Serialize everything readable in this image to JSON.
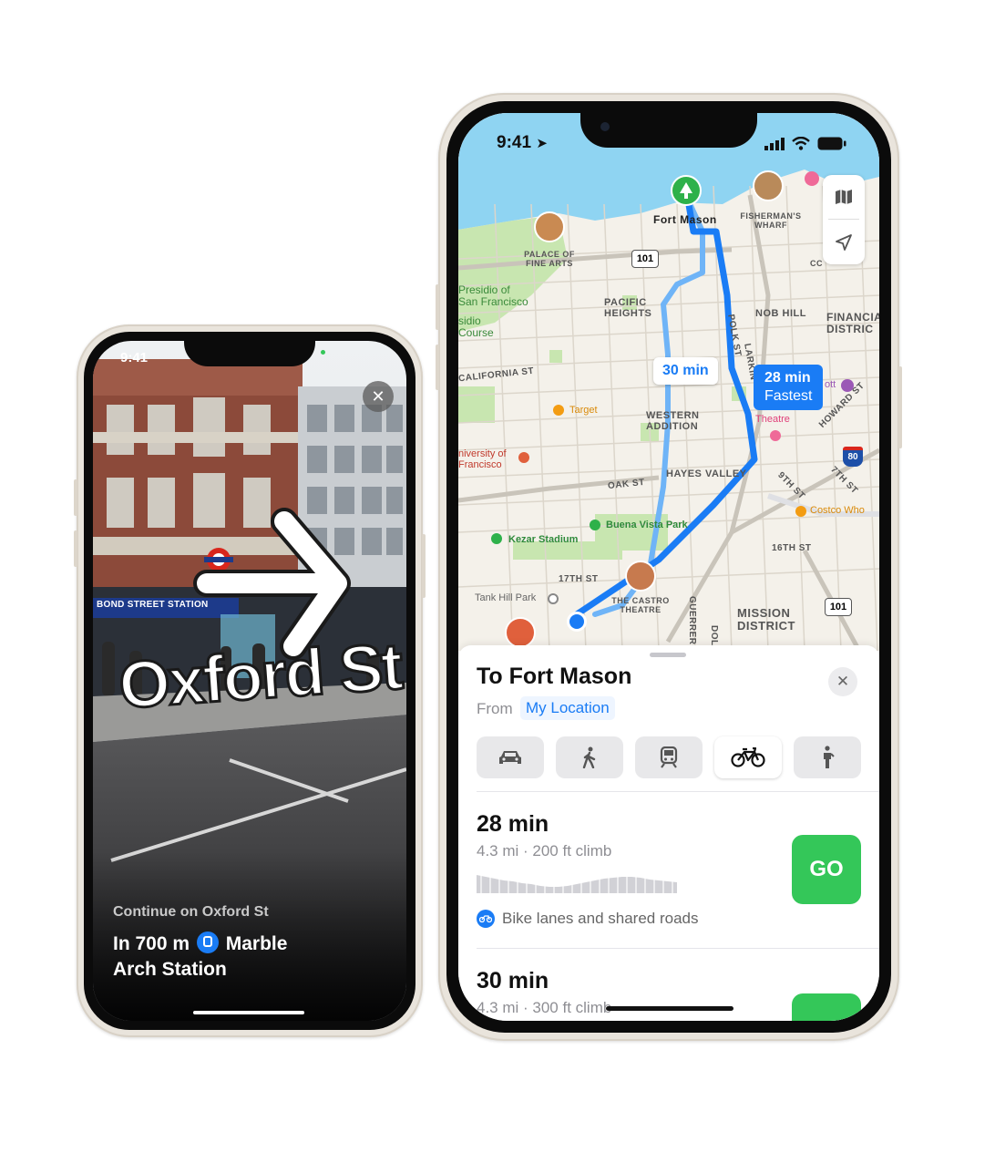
{
  "ar_phone": {
    "status_time": "9:41",
    "street_sign": "BOND STREET STATION",
    "street_label": "Oxford St",
    "instruction": "Continue on Oxford St",
    "distance_prefix": "In 700 m",
    "destination_line1": "Marble",
    "destination_line2": "Arch Station"
  },
  "maps_phone": {
    "status_time": "9:41",
    "map_labels": {
      "fort_mason": "Fort Mason",
      "fishermans_wharf": "FISHERMAN'S WHARF",
      "palace_fine_arts": "PALACE OF FINE ARTS",
      "presidio": "Presidio of San Francisco",
      "presidio_golf": "sidio Course",
      "pacific_heights": "PACIFIC HEIGHTS",
      "nob_hill": "NOB HILL",
      "financial": "FINANCIA DISTRIC",
      "california_st": "CALIFORNIA ST",
      "target": "Target",
      "western_addition": "WESTERN ADDITION",
      "univ_sf": "niversity of Francisco",
      "hayes_valley": "HAYES VALLEY",
      "oak_st": "OAK ST",
      "kezar": "Kezar Stadium",
      "buena_vista": "Buena Vista Park",
      "sixteenth": "16TH ST",
      "seventeenth": "17TH ST",
      "tank_hill": "Tank Hill Park",
      "castro_theatre": "THE CASTRO THEATRE",
      "guerrero": "GUERRERO ST",
      "dolores": "DOLOR",
      "mission": "MISSION DISTRICT",
      "costco": "Costco Who",
      "ninth": "9TH ST",
      "seventh": "7TH ST",
      "howard": "HOWARD ST",
      "polk": "POLK ST",
      "larkin": "LARKIN",
      "theatre": "Theatre",
      "ott": "ott",
      "cc": "CC",
      "hwy101_top": "101",
      "hwy101_bottom": "101",
      "hwy80": "80"
    },
    "route_fast_time": "28 min",
    "route_fast_tag": "Fastest",
    "route_alt_time": "30 min",
    "sheet": {
      "title": "To Fort Mason",
      "from_label": "From",
      "from_value": "My Location",
      "modes": [
        "car-icon",
        "walk-icon",
        "transit-icon",
        "bike-icon",
        "rideshare-icon"
      ],
      "active_mode": "bike",
      "routes": [
        {
          "time": "28 min",
          "detail": "4.3 mi · 200 ft climb",
          "note": "Bike lanes and shared roads",
          "go": "GO"
        },
        {
          "time": "30 min",
          "detail": "4.3 mi · 300 ft climb"
        }
      ]
    }
  },
  "colors": {
    "route_blue": "#1a7cf5",
    "route_alt": "#6fb4f7",
    "go_green": "#34c759",
    "map_bg": "#f4f1ea",
    "water": "#8fd4f2",
    "park": "#c8e6b0"
  }
}
